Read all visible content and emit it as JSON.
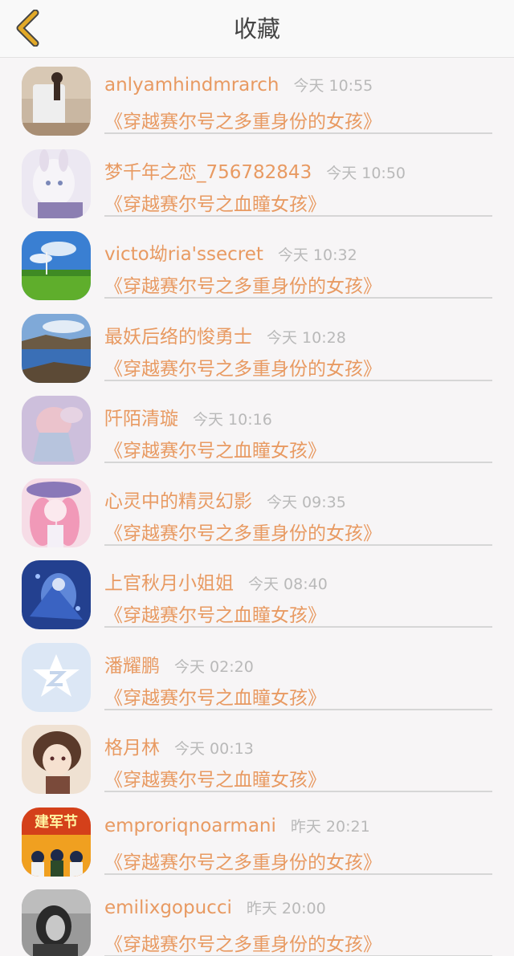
{
  "header": {
    "title": "收藏",
    "back_icon": "chevron-left-icon",
    "accent": "#e2a928"
  },
  "items": [
    {
      "name": "anlyamhindmrarch",
      "time": "今天 10:55",
      "book": "《穿越赛尔号之多重身份的女孩》"
    },
    {
      "name": "梦千年之恋_756782843",
      "time": "今天 10:50",
      "book": "《穿越赛尔号之血瞳女孩》"
    },
    {
      "name": "victo坳ria'ssecret",
      "time": "今天 10:32",
      "book": "《穿越赛尔号之多重身份的女孩》"
    },
    {
      "name": "最妖后络的悛勇士",
      "time": "今天 10:28",
      "book": "《穿越赛尔号之多重身份的女孩》"
    },
    {
      "name": "阡陌清璇",
      "time": "今天 10:16",
      "book": "《穿越赛尔号之血瞳女孩》"
    },
    {
      "name": "心灵中的精灵幻影",
      "time": "今天 09:35",
      "book": "《穿越赛尔号之多重身份的女孩》"
    },
    {
      "name": "上官秋月小姐姐",
      "time": "今天 08:40",
      "book": "《穿越赛尔号之血瞳女孩》"
    },
    {
      "name": "潘耀鹏",
      "time": "今天 02:20",
      "book": "《穿越赛尔号之血瞳女孩》"
    },
    {
      "name": "格月林",
      "time": "今天 00:13",
      "book": "《穿越赛尔号之血瞳女孩》"
    },
    {
      "name": "emproriqnoarmani",
      "time": "昨天 20:21",
      "book": "《穿越赛尔号之多重身份的女孩》",
      "avatar_text": "建军节"
    },
    {
      "name": "emilixgopucci",
      "time": "昨天 20:00",
      "book": "《穿越赛尔号之多重身份的女孩》"
    }
  ]
}
